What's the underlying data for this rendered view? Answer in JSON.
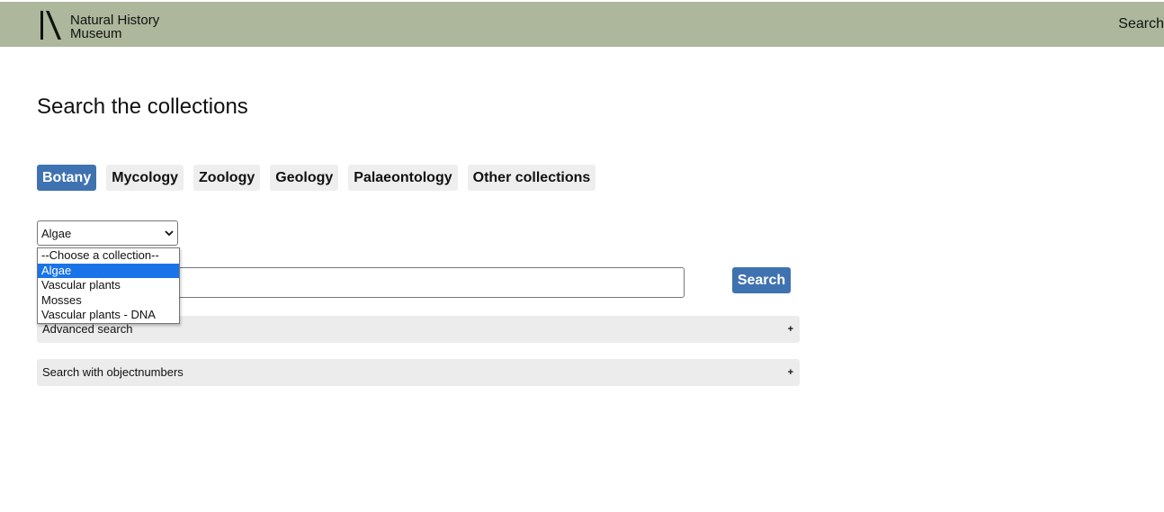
{
  "header": {
    "logo_line1": "Natural History",
    "logo_line2": "Museum",
    "search_link": "Search"
  },
  "main": {
    "title": "Search the collections",
    "tabs": [
      {
        "label": "Botany",
        "active": true
      },
      {
        "label": "Mycology",
        "active": false
      },
      {
        "label": "Zoology",
        "active": false
      },
      {
        "label": "Geology",
        "active": false
      },
      {
        "label": "Palaeontology",
        "active": false
      },
      {
        "label": "Other collections",
        "active": false
      }
    ],
    "collection_select": {
      "value": "Algae",
      "options": [
        {
          "label": "--Choose a collection--",
          "selected": false
        },
        {
          "label": "Algae",
          "selected": true
        },
        {
          "label": "Vascular plants",
          "selected": false
        },
        {
          "label": "Mosses",
          "selected": false
        },
        {
          "label": "Vascular plants - DNA",
          "selected": false
        }
      ]
    },
    "search_input_value": "",
    "search_button": "Search",
    "advanced_search": {
      "label": "Advanced search",
      "toggle": "+"
    },
    "objectnumbers_search": {
      "label": "Search with objectnumbers",
      "toggle": "+"
    }
  },
  "colors": {
    "header_bg": "#adb79b",
    "accent": "#3f72b0",
    "option_highlight": "#1a73e8"
  }
}
